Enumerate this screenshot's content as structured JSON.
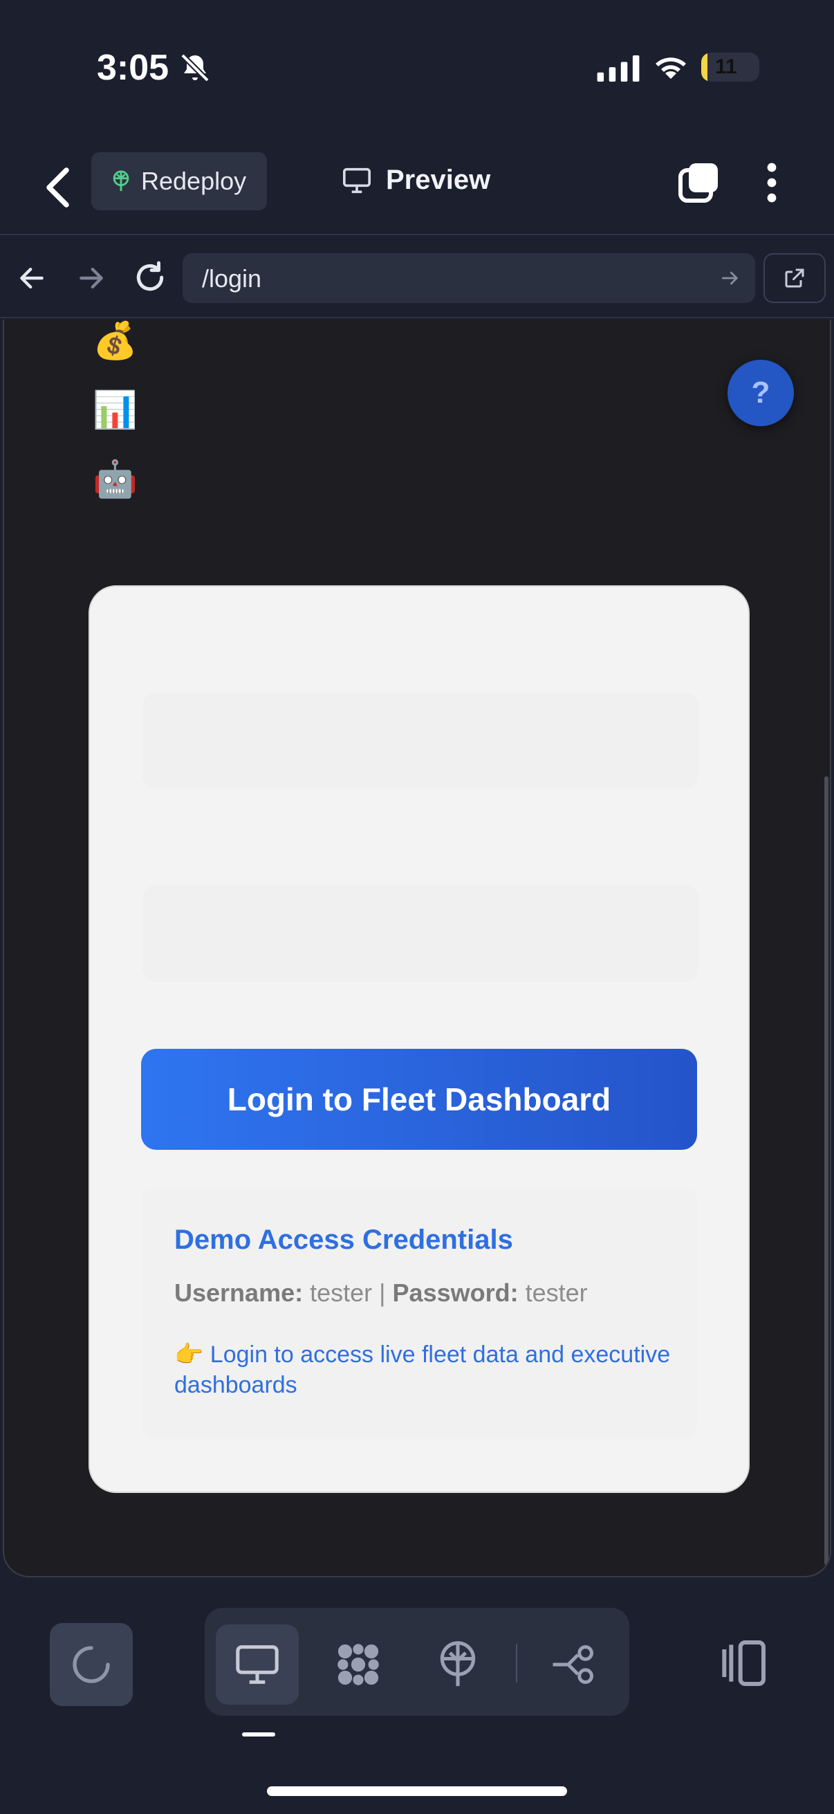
{
  "status_bar": {
    "time": "3:05",
    "battery": "11",
    "battery_level": 0.11
  },
  "header": {
    "redeploy_label": "Redeploy",
    "preview_label": "Preview"
  },
  "urlbar": {
    "url": "/login"
  },
  "page": {
    "emojis": [
      "💰",
      "📊",
      "🤖"
    ],
    "help_label": "?",
    "login_button": "Login to Fleet Dashboard",
    "demo": {
      "title": "Demo Access Credentials",
      "username_label": "Username:",
      "username_value": "tester",
      "separator": "|",
      "password_label": "Password:",
      "password_value": "tester",
      "note_emoji": "👉",
      "note": "Login to access live fleet data and executive dashboards"
    }
  },
  "colors": {
    "accent": "#2f6fe0",
    "help": "#2457c4",
    "battery": "#f5d547"
  }
}
